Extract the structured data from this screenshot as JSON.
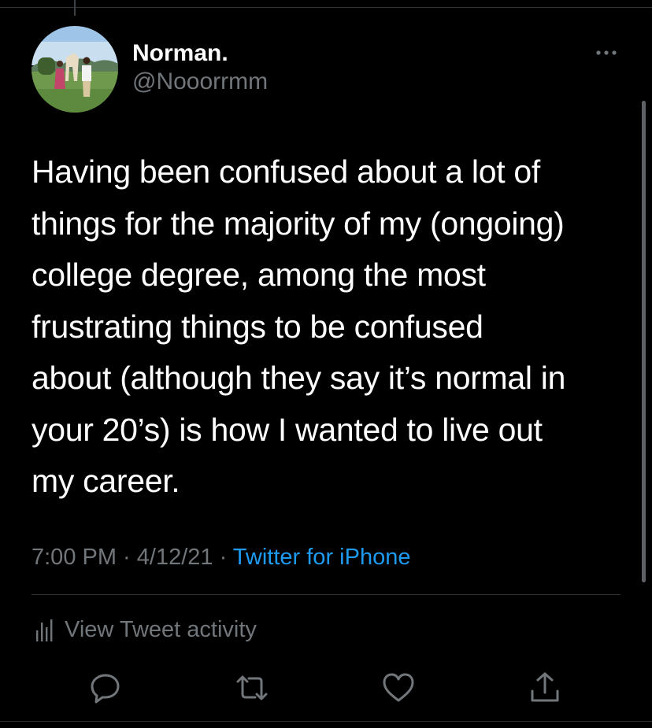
{
  "tweet": {
    "author": {
      "display_name": "Norman.",
      "handle": "@Nooorrmm",
      "avatar_icon": "profile-photo"
    },
    "more_icon": "more-horizontal-icon",
    "text": "Having been confused about a lot of\nthings for the majority of my (ongoing)\ncollege degree, among the most\nfrustrating  things to be confused\nabout (although they say it’s normal in\nyour 20’s) is how I wanted to live out\nmy career.",
    "meta": {
      "time": "7:00 PM",
      "separator": " · ",
      "date": "4/12/21",
      "source": "Twitter for iPhone"
    },
    "activity": {
      "icon": "analytics-icon",
      "label": "View Tweet activity"
    },
    "actions": [
      {
        "name": "reply",
        "icon": "reply-icon"
      },
      {
        "name": "retweet",
        "icon": "retweet-icon"
      },
      {
        "name": "like",
        "icon": "heart-icon"
      },
      {
        "name": "share",
        "icon": "share-icon"
      }
    ]
  },
  "colors": {
    "background": "#000000",
    "primary_text": "#ffffff",
    "secondary_text": "#71767b",
    "link": "#1d9bf0",
    "divider": "#2f3336"
  }
}
